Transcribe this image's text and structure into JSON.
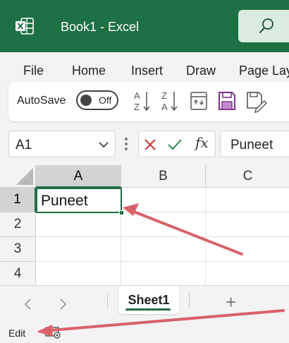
{
  "titlebar": {
    "app_icon": "excel-logo-icon",
    "title": "Book1  -  Excel",
    "search_icon": "search-icon",
    "color": "#1d7044"
  },
  "ribbon": {
    "tabs": [
      "File",
      "Home",
      "Insert",
      "Draw",
      "Page Lay"
    ]
  },
  "quick_access": {
    "autosave_label": "AutoSave",
    "autosave_state": "Off",
    "icons": [
      "sort-ascending-icon",
      "sort-descending-icon",
      "calendar-icon",
      "save-icon",
      "save-edit-icon"
    ]
  },
  "formula_bar": {
    "name_box_value": "A1",
    "cancel_icon": "cancel-icon",
    "enter_icon": "checkmark-icon",
    "insert_function_label": "fx",
    "formula_value": "Puneet"
  },
  "grid": {
    "columns": [
      "A",
      "B",
      "C"
    ],
    "rows": [
      "1",
      "2",
      "3",
      "4"
    ],
    "cells": {
      "A1": "Puneet"
    },
    "selected_cell": "A1"
  },
  "sheets": {
    "tabs": [
      "Sheet1"
    ],
    "active": "Sheet1",
    "add_label": "+"
  },
  "status": {
    "mode": "Edit",
    "icon": "cell-mode-icon"
  },
  "annotation_color": "#d9626a"
}
